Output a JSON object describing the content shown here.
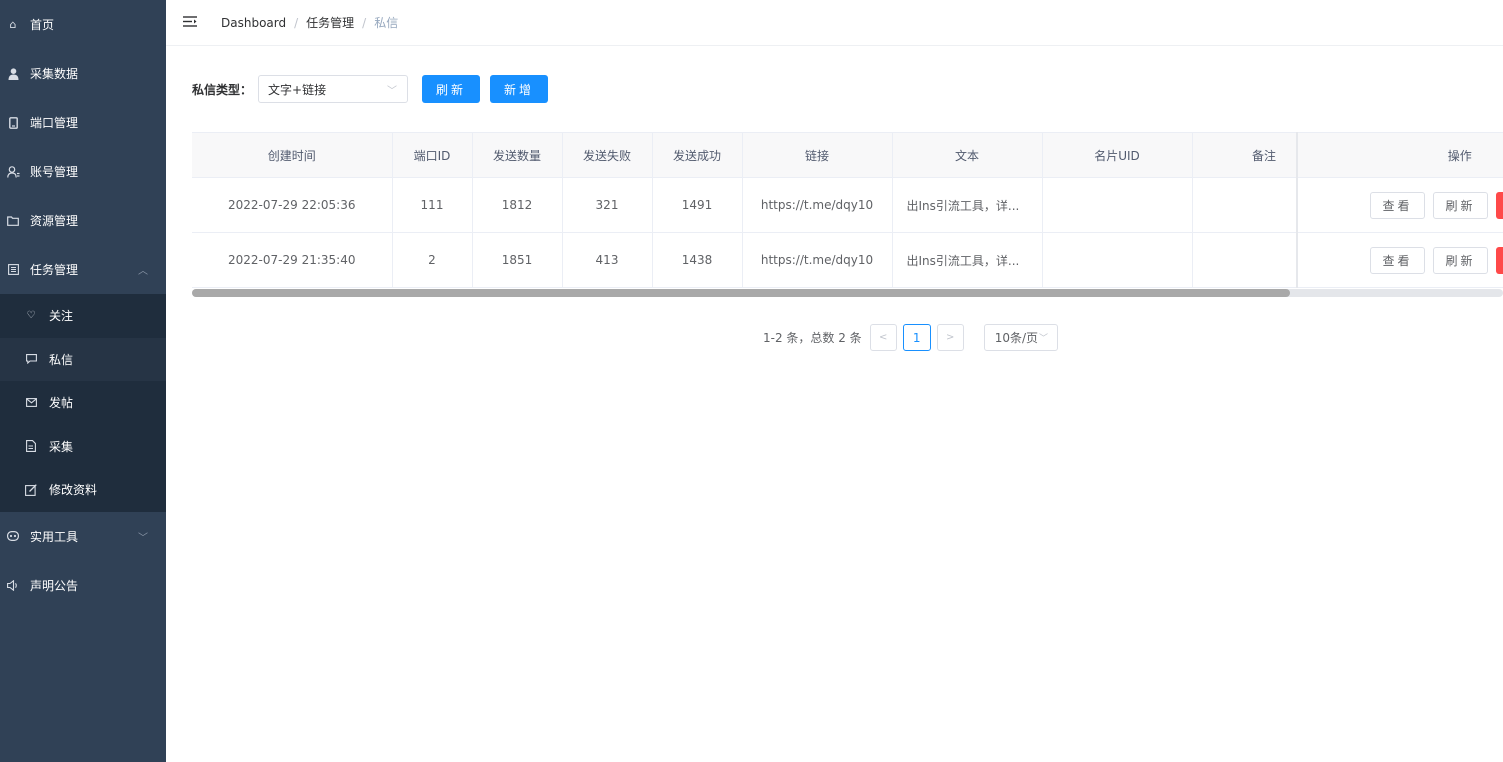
{
  "sidebar": {
    "items": [
      {
        "label": "首页",
        "icon": "home-icon"
      },
      {
        "label": "采集数据",
        "icon": "user-icon"
      },
      {
        "label": "端口管理",
        "icon": "mobile-icon"
      },
      {
        "label": "账号管理",
        "icon": "account-icon"
      },
      {
        "label": "资源管理",
        "icon": "folder-icon"
      },
      {
        "label": "任务管理",
        "icon": "task-icon"
      },
      {
        "label": "实用工具",
        "icon": "tools-icon"
      },
      {
        "label": "声明公告",
        "icon": "speaker-icon"
      }
    ],
    "task_sub": [
      {
        "label": "关注",
        "icon": "heart-icon"
      },
      {
        "label": "私信",
        "icon": "message-icon"
      },
      {
        "label": "发帖",
        "icon": "mail-icon"
      },
      {
        "label": "采集",
        "icon": "document-icon"
      },
      {
        "label": "修改资料",
        "icon": "edit-icon"
      }
    ]
  },
  "breadcrumb": [
    "Dashboard",
    "任务管理",
    "私信"
  ],
  "filter": {
    "label": "私信类型：",
    "type_value": "文字+链接",
    "refresh_label": "刷新",
    "add_label": "新增"
  },
  "table": {
    "headers": [
      "创建时间",
      "端口ID",
      "发送数量",
      "发送失败",
      "发送成功",
      "链接",
      "文本",
      "名片UID",
      "备注",
      "操作"
    ],
    "rows": [
      {
        "created": "2022-07-29 22:05:36",
        "port_id": "111",
        "sent": "1812",
        "failed": "321",
        "success": "1491",
        "link": "https://t.me/dqy10",
        "text": "出Ins引流工具，详...",
        "card_uid": "",
        "remark": "",
        "view": "查看",
        "refresh": "刷新"
      },
      {
        "created": "2022-07-29 21:35:40",
        "port_id": "2",
        "sent": "1851",
        "failed": "413",
        "success": "1438",
        "link": "https://t.me/dqy10",
        "text": "出Ins引流工具，详...",
        "card_uid": "",
        "remark": "",
        "view": "查看",
        "refresh": "刷新"
      }
    ]
  },
  "pagination": {
    "total_text": "1-2 条，总数 2 条",
    "current_page": "1",
    "page_size": "10条/页"
  },
  "colors": {
    "sidebar_bg": "#304156",
    "submenu_bg": "#1f2d3d",
    "primary": "#1890ff",
    "danger": "#ff4949"
  }
}
